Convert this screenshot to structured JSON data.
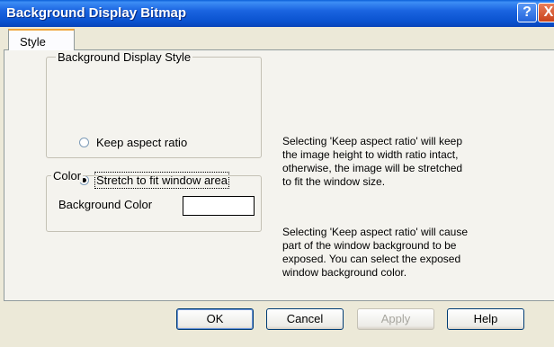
{
  "window": {
    "title": "Background Display Bitmap",
    "help_glyph": "?",
    "close_glyph": "X",
    "titlebar_color": "#0a52cf"
  },
  "tabs": [
    {
      "label": "Style",
      "selected": true
    }
  ],
  "style_group": {
    "legend": "Background Display Style",
    "options": [
      {
        "label": "Keep aspect ratio",
        "checked": false
      },
      {
        "label": "Stretch to fit window area",
        "checked": true
      }
    ]
  },
  "color_group": {
    "legend": "Color",
    "label": "Background Color",
    "value": "#ffffff"
  },
  "descriptions": {
    "aspect": [
      "Selecting 'Keep aspect ratio' will keep",
      "the image height to width ratio intact,",
      "otherwise, the image will be stretched",
      "to fit the window size."
    ],
    "color": [
      "Selecting 'Keep aspect ratio' will cause",
      "part of the window background to be",
      "exposed.  You can select the exposed",
      "window background color."
    ]
  },
  "buttons": {
    "ok": "OK",
    "cancel": "Cancel",
    "apply": "Apply",
    "help": "Help"
  }
}
